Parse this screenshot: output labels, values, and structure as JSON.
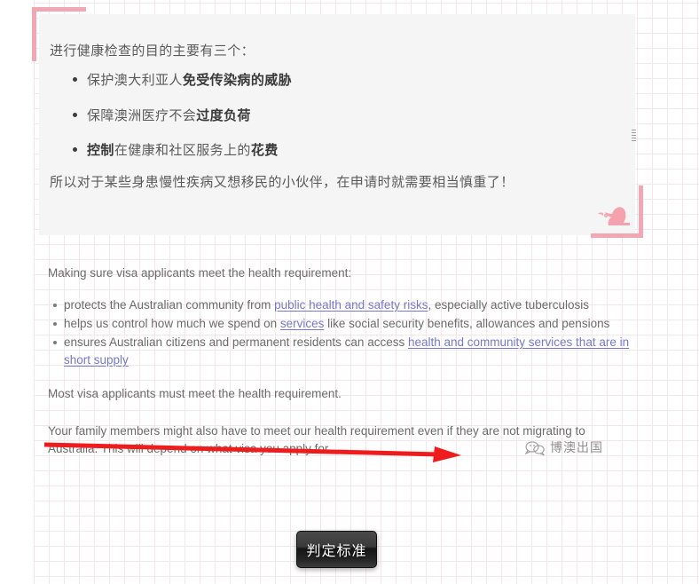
{
  "quote_card": {
    "intro": "进行健康检查的目的主要有三个：",
    "bullets": [
      {
        "plain_before": "保护澳大利亚人",
        "bold": "免受传染病的威胁",
        "plain_after": ""
      },
      {
        "plain_before": "保障澳洲医疗不会",
        "bold": "过度负荷",
        "plain_after": ""
      },
      {
        "plain_before": "",
        "bold": "控制",
        "plain_after": "在健康和社区服务上的",
        "bold_tail": "花费"
      }
    ],
    "outro": "所以对于某些身患慢性疾病又想移民的小伙伴，在申请时就需要相当慎重了！",
    "accent_color": "#f2a8b4",
    "background_color": "#f5f5f5"
  },
  "english_block": {
    "lead": "Making sure visa applicants meet the health requirement:",
    "bullets": [
      {
        "prefix": "protects the Australian community from ",
        "link": "public health and safety risks",
        "suffix": ", especially active tuberculosis"
      },
      {
        "prefix": "helps us control how much we spend on ",
        "link": "services",
        "suffix": " like social security benefits, allowances and pensions"
      },
      {
        "prefix": "ensures Australian citizens and permanent residents can access ",
        "link": "health and community services that are in short supply",
        "suffix": ""
      }
    ],
    "mid_paragraph": "Most visa applicants must meet the health requirement.",
    "last_paragraph": "Your family members might also have to meet our health requirement even if they are not migrating to Australia. This will depend on what visa you apply for.",
    "link_color": "#7579c9",
    "text_color": "#6b6b6b"
  },
  "annotation": {
    "arrow_color": "#ee1c1c",
    "arrow_label": "red-arrow-pointing-right"
  },
  "watermark": {
    "text": "博澳出国",
    "icon": "wechat-icon",
    "color": "#8f8f8f"
  },
  "bottom_button": {
    "label": "判定标准"
  },
  "background": {
    "grid_color": "#f3e7e9",
    "page_color": "#ffffff"
  }
}
